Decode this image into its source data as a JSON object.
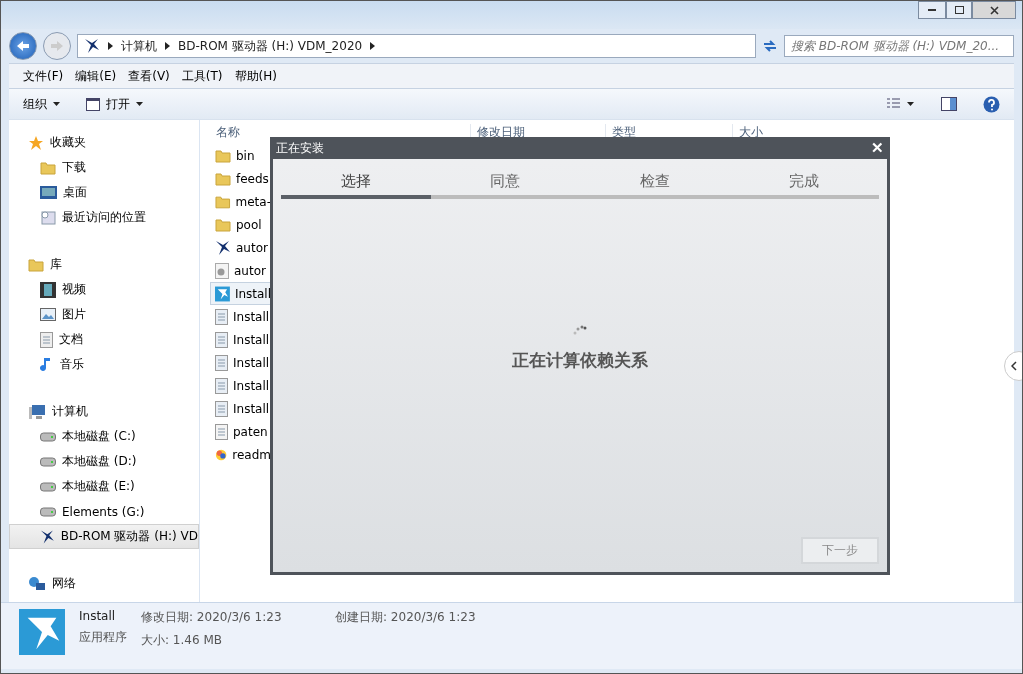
{
  "address": {
    "crumbs": [
      "计算机",
      "BD-ROM 驱动器 (H:) VDM_2020"
    ],
    "search_placeholder": "搜索 BD-ROM 驱动器 (H:) VDM_20..."
  },
  "menu": [
    "文件(F)",
    "编辑(E)",
    "查看(V)",
    "工具(T)",
    "帮助(H)"
  ],
  "toolbar": [
    {
      "label": "组织",
      "kind": "menu"
    },
    {
      "label": "打开",
      "kind": "open"
    }
  ],
  "nav": [
    {
      "label": "收藏夹",
      "kind": "star",
      "children": [
        {
          "label": "下载",
          "kind": "folder",
          "selected": false
        },
        {
          "label": "桌面",
          "kind": "desktop",
          "selected": false
        },
        {
          "label": "最近访问的位置",
          "kind": "recent",
          "selected": false
        }
      ]
    },
    {
      "label": "库",
      "kind": "library",
      "children": [
        {
          "label": "视频",
          "kind": "video",
          "selected": false
        },
        {
          "label": "图片",
          "kind": "image",
          "selected": false
        },
        {
          "label": "文档",
          "kind": "doc",
          "selected": false
        },
        {
          "label": "音乐",
          "kind": "music",
          "selected": false
        }
      ]
    },
    {
      "label": "计算机",
      "kind": "computer",
      "children": [
        {
          "label": "本地磁盘 (C:)",
          "kind": "drive",
          "selected": false
        },
        {
          "label": "本地磁盘 (D:)",
          "kind": "drive",
          "selected": false
        },
        {
          "label": "本地磁盘 (E:)",
          "kind": "drive",
          "selected": false
        },
        {
          "label": "Elements (G:)",
          "kind": "drive",
          "selected": false
        },
        {
          "label": "BD-ROM 驱动器 (H:) VD",
          "kind": "ni",
          "selected": true
        }
      ]
    },
    {
      "label": "网络",
      "kind": "network"
    }
  ],
  "columns": [
    "名称",
    "修改日期",
    "类型",
    "大小"
  ],
  "files": [
    {
      "name": "bin",
      "kind": "folder",
      "selected": false
    },
    {
      "name": "feeds",
      "kind": "folder",
      "selected": false
    },
    {
      "name": "meta-",
      "kind": "folder",
      "selected": false
    },
    {
      "name": "pool",
      "kind": "folder",
      "selected": false
    },
    {
      "name": "autor",
      "kind": "ni",
      "selected": false
    },
    {
      "name": "autor",
      "kind": "gear",
      "selected": false
    },
    {
      "name": "Install",
      "kind": "app",
      "selected": true
    },
    {
      "name": "Install",
      "kind": "dll",
      "selected": false
    },
    {
      "name": "Install",
      "kind": "dll",
      "selected": false
    },
    {
      "name": "Install",
      "kind": "dll",
      "selected": false
    },
    {
      "name": "Install",
      "kind": "dll",
      "selected": false
    },
    {
      "name": "Install",
      "kind": "dll",
      "selected": false
    },
    {
      "name": "paten",
      "kind": "text",
      "selected": false
    },
    {
      "name": "readm",
      "kind": "color",
      "selected": false
    }
  ],
  "details": {
    "name": "Install",
    "type": "应用程序",
    "modified": "修改日期: 2020/3/6 1:23",
    "created": "创建日期: 2020/3/6 1:23",
    "size": "大小: 1.46 MB"
  },
  "dialog": {
    "title": "正在安装",
    "close": "✕",
    "steps": [
      {
        "label": "选择",
        "selected": true
      },
      {
        "label": "同意",
        "selected": false
      },
      {
        "label": "检查",
        "selected": false
      },
      {
        "label": "完成",
        "selected": false
      }
    ],
    "message": "正在计算依赖关系",
    "next": {
      "label": "下一步",
      "disabled": true
    }
  }
}
